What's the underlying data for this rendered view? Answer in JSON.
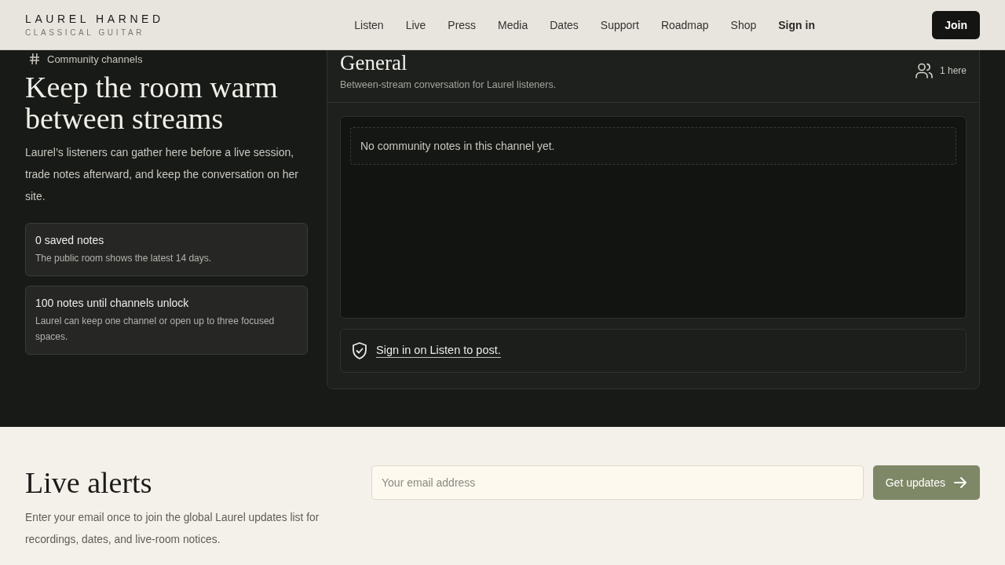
{
  "header": {
    "brand": "LAUREL HARNED",
    "tagline": "CLASSICAL GUITAR",
    "nav": [
      {
        "label": "Listen",
        "kind": "link"
      },
      {
        "label": "Live",
        "kind": "link"
      },
      {
        "label": "Press",
        "kind": "link"
      },
      {
        "label": "Media",
        "kind": "link"
      },
      {
        "label": "Dates",
        "kind": "link"
      },
      {
        "label": "Support",
        "kind": "link"
      },
      {
        "label": "Roadmap",
        "kind": "link"
      },
      {
        "label": "Shop",
        "kind": "link"
      },
      {
        "label": "Sign in",
        "kind": "account"
      }
    ],
    "join_button": "Join"
  },
  "intro": {
    "eyebrow": "Community channels",
    "title": "Keep the room warm between streams",
    "body": "Laurel’s listeners can gather here before a live session, trade notes afterward, and keep the conversation on her site.",
    "stats": [
      {
        "title": "0 saved notes",
        "text": "The public room shows the latest 14 days."
      },
      {
        "title": "100 notes until channels unlock",
        "text": "Laurel can keep one channel or open up to three focused spaces."
      }
    ]
  },
  "channel": {
    "name": "General",
    "description": "Between-stream conversation for Laurel listeners.",
    "presence": "1 here",
    "empty_message": "No community notes in this channel yet.",
    "sign_in_link": "Sign in on Listen to post."
  },
  "alerts": {
    "title": "Live alerts",
    "body": "Enter your email once to join the global Laurel updates list for recordings, dates, and live-room notices.",
    "email_placeholder": "Your email address",
    "button": "Get updates"
  }
}
